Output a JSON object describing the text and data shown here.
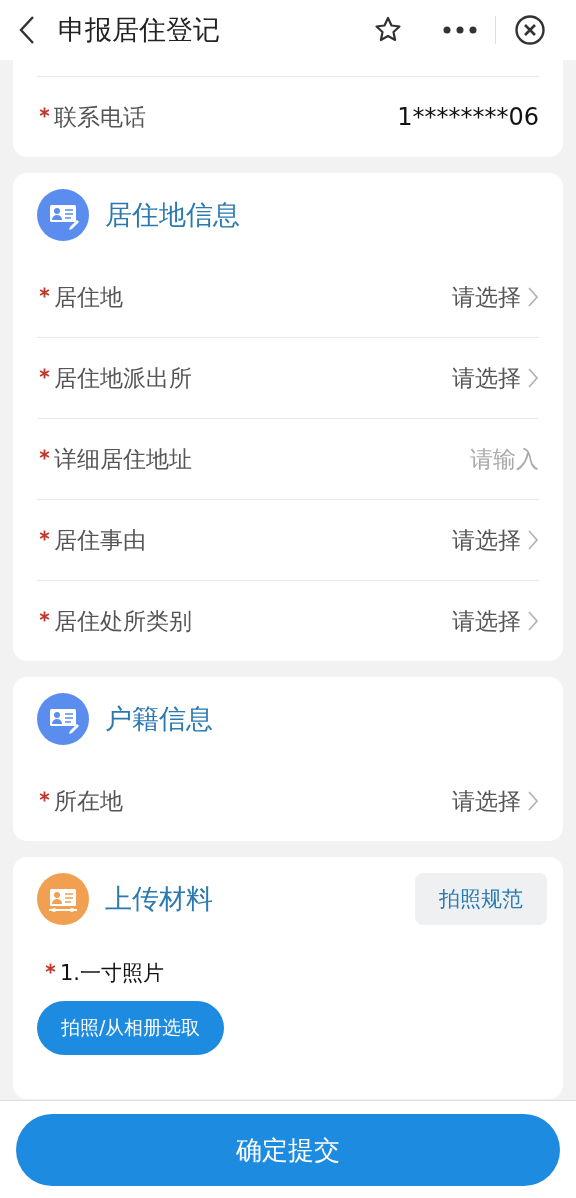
{
  "header": {
    "title": "申报居住登记"
  },
  "contact": {
    "label": "联系电话",
    "required": true,
    "value": "1********06"
  },
  "sections": [
    {
      "title": "居住地信息",
      "color": "#5b8def",
      "rows": [
        {
          "label": "居住地",
          "required": true,
          "kind": "select",
          "value": "请选择"
        },
        {
          "label": "居住地派出所",
          "required": true,
          "kind": "select",
          "value": "请选择"
        },
        {
          "label": "详细居住地址",
          "required": true,
          "kind": "input",
          "placeholder": "请输入"
        },
        {
          "label": "居住事由",
          "required": true,
          "kind": "select",
          "value": "请选择"
        },
        {
          "label": "居住处所类别",
          "required": true,
          "kind": "select",
          "value": "请选择"
        }
      ]
    },
    {
      "title": "户籍信息",
      "color": "#5b8def",
      "rows": [
        {
          "label": "所在地",
          "required": true,
          "kind": "select",
          "value": "请选择"
        }
      ]
    }
  ],
  "upload": {
    "title": "上传材料",
    "color": "#f0a050",
    "guide_button": "拍照规范",
    "item": {
      "label": "1.一寸照片",
      "required": true
    },
    "pick_button": "拍照/从相册选取"
  },
  "submit_button": "确定提交"
}
